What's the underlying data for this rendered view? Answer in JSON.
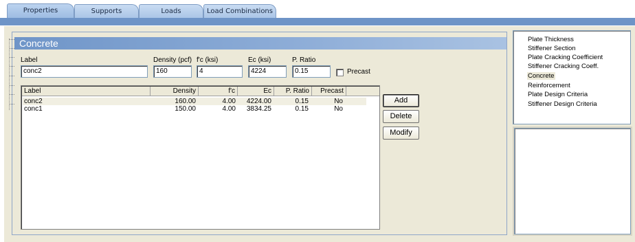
{
  "tabs": [
    {
      "label": "Properties",
      "active": true
    },
    {
      "label": "Supports",
      "active": false
    },
    {
      "label": "Loads",
      "active": false
    },
    {
      "label": "Load Combinations",
      "active": false
    }
  ],
  "section": {
    "title": "Concrete"
  },
  "form": {
    "label": {
      "caption": "Label",
      "value": "conc2"
    },
    "density": {
      "caption": "Density (pcf)",
      "value": "160"
    },
    "fc": {
      "caption": "f'c (ksi)",
      "value": "4"
    },
    "ec": {
      "caption": "Ec (ksi)",
      "value": "4224"
    },
    "pratio": {
      "caption": "P. Ratio",
      "value": "0.15"
    },
    "precast": {
      "caption": "Precast",
      "checked": false
    }
  },
  "table": {
    "columns": [
      "Label",
      "Density",
      "f'c",
      "Ec",
      "P. Ratio",
      "Precast"
    ],
    "rows": [
      {
        "label": "conc2",
        "density": "160.00",
        "fc": "4.00",
        "ec": "4224.00",
        "pratio": "0.15",
        "precast": "No",
        "selected": true
      },
      {
        "label": "conc1",
        "density": "150.00",
        "fc": "4.00",
        "ec": "3834.25",
        "pratio": "0.15",
        "precast": "No",
        "selected": false
      }
    ]
  },
  "buttons": {
    "add": "Add",
    "delete": "Delete",
    "modify": "Modify"
  },
  "tree": {
    "items": [
      "Plate Thickness",
      "Stiffener Section",
      "Plate Cracking Coefficient",
      "Stiffener Cracking Coeff.",
      "Concrete",
      "Reinforcement",
      "Plate Design Criteria",
      "Stiffener Design Criteria"
    ],
    "selected": "Concrete"
  },
  "colors": {
    "tab_bar": "#6e94c7",
    "header_bar": "#6f95c8",
    "panel_bg": "#ece9d8",
    "selection": "#f1efe2"
  }
}
